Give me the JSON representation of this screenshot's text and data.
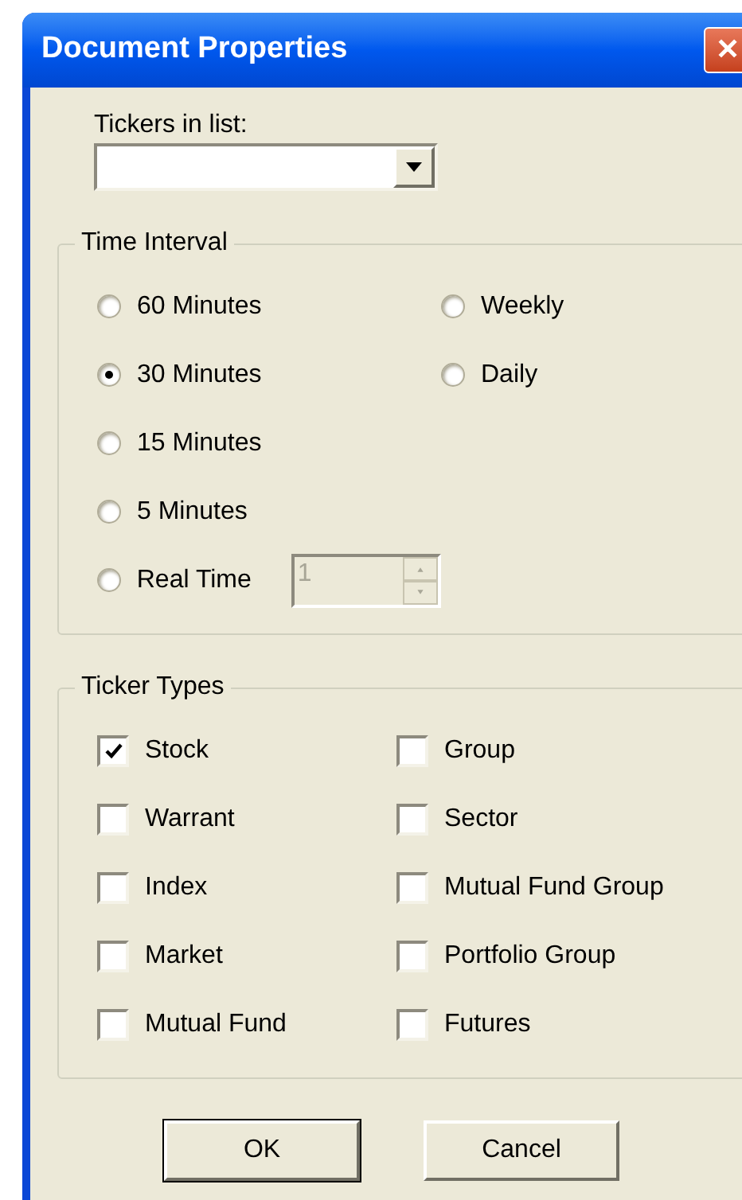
{
  "window": {
    "title": "Document Properties",
    "close": "✕"
  },
  "tickers_in_list": {
    "label": "Tickers in list:"
  },
  "time_interval": {
    "title": "Time Interval",
    "left": [
      {
        "label": "60 Minutes",
        "selected": false
      },
      {
        "label": "30 Minutes",
        "selected": true
      },
      {
        "label": "15 Minutes",
        "selected": false
      },
      {
        "label": "5 Minutes",
        "selected": false
      },
      {
        "label": "Real Time",
        "selected": false,
        "spinner": {
          "value": "1",
          "disabled": true
        }
      }
    ],
    "right": [
      {
        "label": "Weekly",
        "selected": false
      },
      {
        "label": "Daily",
        "selected": false
      }
    ]
  },
  "ticker_types": {
    "title": "Ticker Types",
    "left": [
      {
        "label": "Stock",
        "checked": true
      },
      {
        "label": "Warrant",
        "checked": false
      },
      {
        "label": "Index",
        "checked": false
      },
      {
        "label": "Market",
        "checked": false
      },
      {
        "label": "Mutual Fund",
        "checked": false
      }
    ],
    "right": [
      {
        "label": "Group",
        "checked": false
      },
      {
        "label": "Sector",
        "checked": false
      },
      {
        "label": "Mutual Fund Group",
        "checked": false
      },
      {
        "label": "Portfolio Group",
        "checked": false
      },
      {
        "label": "Futures",
        "checked": false
      }
    ]
  },
  "buttons": [
    {
      "label": "OK",
      "default": true
    },
    {
      "label": "Cancel",
      "default": false
    }
  ]
}
